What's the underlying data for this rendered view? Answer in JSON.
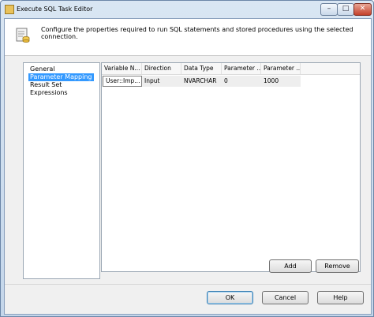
{
  "window": {
    "title": "Execute SQL Task Editor",
    "controls": {
      "minimize": "–",
      "maximize": "□",
      "close": "✕"
    }
  },
  "header": {
    "description": "Configure the properties required to run SQL statements and stored procedures using the selected connection."
  },
  "nav": {
    "items": [
      {
        "label": "General",
        "selected": false
      },
      {
        "label": "Parameter Mapping",
        "selected": true
      },
      {
        "label": "Result Set",
        "selected": false
      },
      {
        "label": "Expressions",
        "selected": false
      }
    ]
  },
  "grid": {
    "columns": [
      "Variable N...",
      "Direction",
      "Data Type",
      "Parameter ...",
      "Parameter ..."
    ],
    "rows": [
      [
        "User::Imp...",
        "Input",
        "NVARCHAR",
        "0",
        "1000"
      ]
    ]
  },
  "buttons": {
    "add": "Add",
    "remove": "Remove",
    "ok": "OK",
    "cancel": "Cancel",
    "help": "Help"
  },
  "colors": {
    "selection": "#3399ff",
    "frame": "#c4d6ea"
  }
}
